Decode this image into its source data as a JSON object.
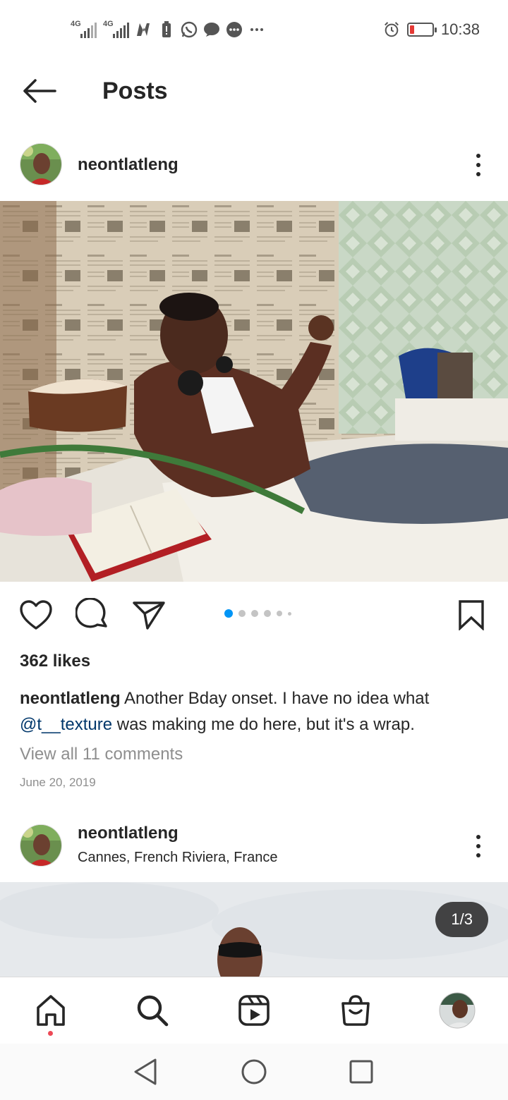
{
  "status_bar": {
    "net1": "4G",
    "net2": "4G",
    "time": "10:38"
  },
  "header": {
    "title": "Posts"
  },
  "post1": {
    "username": "neontlatleng",
    "likes": "362 likes",
    "caption_username": "neontlatleng",
    "caption_part1": " Another Bday onset. I have no idea what ",
    "caption_mention": "@t__texture",
    "caption_part2": " was making me do here, but it's a wrap.",
    "view_comments": "View all 11 comments",
    "date": "June 20, 2019",
    "carousel_dots": 6,
    "carousel_active": 0,
    "accent_color": "#0095f6"
  },
  "post2": {
    "username": "neontlatleng",
    "location": "Cannes, French Riviera, France",
    "counter": "1/3"
  },
  "nav": {
    "items": [
      "home-icon",
      "search-icon",
      "reels-icon",
      "shop-icon",
      "profile-avatar"
    ]
  },
  "system_nav": {
    "items": [
      "back-triangle-icon",
      "home-circle-icon",
      "recents-square-icon"
    ]
  }
}
